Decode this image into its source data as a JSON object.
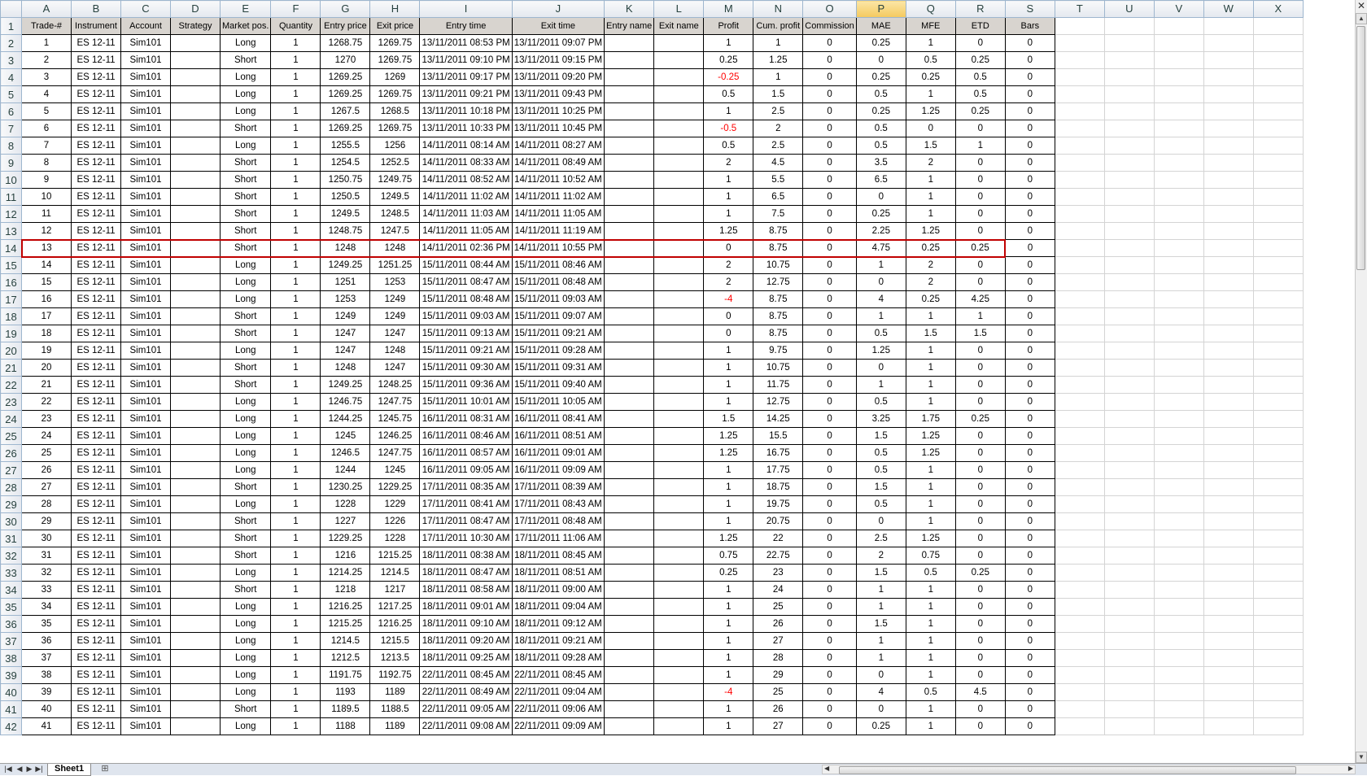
{
  "column_letters": [
    "A",
    "B",
    "C",
    "D",
    "E",
    "F",
    "G",
    "H",
    "I",
    "J",
    "K",
    "L",
    "M",
    "N",
    "O",
    "P",
    "Q",
    "R",
    "S",
    "T",
    "U",
    "V",
    "W",
    "X"
  ],
  "selected_column": "P",
  "headers": [
    "Trade-#",
    "Instrument",
    "Account",
    "Strategy",
    "Market pos.",
    "Quantity",
    "Entry price",
    "Exit price",
    "Entry time",
    "Exit time",
    "Entry name",
    "Exit name",
    "Profit",
    "Cum. profit",
    "Commission",
    "MAE",
    "MFE",
    "ETD",
    "Bars"
  ],
  "highlighted_row": 14,
  "rows": [
    [
      "1",
      "ES 12-11",
      "Sim101",
      "",
      "Long",
      "1",
      "1268.75",
      "1269.75",
      "13/11/2011 08:53 PM",
      "13/11/2011 09:07 PM",
      "",
      "",
      "1",
      "1",
      "0",
      "0.25",
      "1",
      "0",
      "0"
    ],
    [
      "2",
      "ES 12-11",
      "Sim101",
      "",
      "Short",
      "1",
      "1270",
      "1269.75",
      "13/11/2011 09:10 PM",
      "13/11/2011 09:15 PM",
      "",
      "",
      "0.25",
      "1.25",
      "0",
      "0",
      "0.5",
      "0.25",
      "0"
    ],
    [
      "3",
      "ES 12-11",
      "Sim101",
      "",
      "Long",
      "1",
      "1269.25",
      "1269",
      "13/11/2011 09:17 PM",
      "13/11/2011 09:20 PM",
      "",
      "",
      "-0.25",
      "1",
      "0",
      "0.25",
      "0.25",
      "0.5",
      "0"
    ],
    [
      "4",
      "ES 12-11",
      "Sim101",
      "",
      "Long",
      "1",
      "1269.25",
      "1269.75",
      "13/11/2011 09:21 PM",
      "13/11/2011 09:43 PM",
      "",
      "",
      "0.5",
      "1.5",
      "0",
      "0.5",
      "1",
      "0.5",
      "0"
    ],
    [
      "5",
      "ES 12-11",
      "Sim101",
      "",
      "Long",
      "1",
      "1267.5",
      "1268.5",
      "13/11/2011 10:18 PM",
      "13/11/2011 10:25 PM",
      "",
      "",
      "1",
      "2.5",
      "0",
      "0.25",
      "1.25",
      "0.25",
      "0"
    ],
    [
      "6",
      "ES 12-11",
      "Sim101",
      "",
      "Short",
      "1",
      "1269.25",
      "1269.75",
      "13/11/2011 10:33 PM",
      "13/11/2011 10:45 PM",
      "",
      "",
      "-0.5",
      "2",
      "0",
      "0.5",
      "0",
      "0",
      "0"
    ],
    [
      "7",
      "ES 12-11",
      "Sim101",
      "",
      "Long",
      "1",
      "1255.5",
      "1256",
      "14/11/2011 08:14 AM",
      "14/11/2011 08:27 AM",
      "",
      "",
      "0.5",
      "2.5",
      "0",
      "0.5",
      "1.5",
      "1",
      "0"
    ],
    [
      "8",
      "ES 12-11",
      "Sim101",
      "",
      "Short",
      "1",
      "1254.5",
      "1252.5",
      "14/11/2011 08:33 AM",
      "14/11/2011 08:49 AM",
      "",
      "",
      "2",
      "4.5",
      "0",
      "3.5",
      "2",
      "0",
      "0"
    ],
    [
      "9",
      "ES 12-11",
      "Sim101",
      "",
      "Short",
      "1",
      "1250.75",
      "1249.75",
      "14/11/2011 08:52 AM",
      "14/11/2011 10:52 AM",
      "",
      "",
      "1",
      "5.5",
      "0",
      "6.5",
      "1",
      "0",
      "0"
    ],
    [
      "10",
      "ES 12-11",
      "Sim101",
      "",
      "Short",
      "1",
      "1250.5",
      "1249.5",
      "14/11/2011 11:02 AM",
      "14/11/2011 11:02 AM",
      "",
      "",
      "1",
      "6.5",
      "0",
      "0",
      "1",
      "0",
      "0"
    ],
    [
      "11",
      "ES 12-11",
      "Sim101",
      "",
      "Short",
      "1",
      "1249.5",
      "1248.5",
      "14/11/2011 11:03 AM",
      "14/11/2011 11:05 AM",
      "",
      "",
      "1",
      "7.5",
      "0",
      "0.25",
      "1",
      "0",
      "0"
    ],
    [
      "12",
      "ES 12-11",
      "Sim101",
      "",
      "Short",
      "1",
      "1248.75",
      "1247.5",
      "14/11/2011 11:05 AM",
      "14/11/2011 11:19 AM",
      "",
      "",
      "1.25",
      "8.75",
      "0",
      "2.25",
      "1.25",
      "0",
      "0"
    ],
    [
      "13",
      "ES 12-11",
      "Sim101",
      "",
      "Short",
      "1",
      "1248",
      "1248",
      "14/11/2011 02:36 PM",
      "14/11/2011 10:55 PM",
      "",
      "",
      "0",
      "8.75",
      "0",
      "4.75",
      "0.25",
      "0.25",
      "0"
    ],
    [
      "14",
      "ES 12-11",
      "Sim101",
      "",
      "Long",
      "1",
      "1249.25",
      "1251.25",
      "15/11/2011 08:44 AM",
      "15/11/2011 08:46 AM",
      "",
      "",
      "2",
      "10.75",
      "0",
      "1",
      "2",
      "0",
      "0"
    ],
    [
      "15",
      "ES 12-11",
      "Sim101",
      "",
      "Long",
      "1",
      "1251",
      "1253",
      "15/11/2011 08:47 AM",
      "15/11/2011 08:48 AM",
      "",
      "",
      "2",
      "12.75",
      "0",
      "0",
      "2",
      "0",
      "0"
    ],
    [
      "16",
      "ES 12-11",
      "Sim101",
      "",
      "Long",
      "1",
      "1253",
      "1249",
      "15/11/2011 08:48 AM",
      "15/11/2011 09:03 AM",
      "",
      "",
      "-4",
      "8.75",
      "0",
      "4",
      "0.25",
      "4.25",
      "0"
    ],
    [
      "17",
      "ES 12-11",
      "Sim101",
      "",
      "Short",
      "1",
      "1249",
      "1249",
      "15/11/2011 09:03 AM",
      "15/11/2011 09:07 AM",
      "",
      "",
      "0",
      "8.75",
      "0",
      "1",
      "1",
      "1",
      "0"
    ],
    [
      "18",
      "ES 12-11",
      "Sim101",
      "",
      "Short",
      "1",
      "1247",
      "1247",
      "15/11/2011 09:13 AM",
      "15/11/2011 09:21 AM",
      "",
      "",
      "0",
      "8.75",
      "0",
      "0.5",
      "1.5",
      "1.5",
      "0"
    ],
    [
      "19",
      "ES 12-11",
      "Sim101",
      "",
      "Long",
      "1",
      "1247",
      "1248",
      "15/11/2011 09:21 AM",
      "15/11/2011 09:28 AM",
      "",
      "",
      "1",
      "9.75",
      "0",
      "1.25",
      "1",
      "0",
      "0"
    ],
    [
      "20",
      "ES 12-11",
      "Sim101",
      "",
      "Short",
      "1",
      "1248",
      "1247",
      "15/11/2011 09:30 AM",
      "15/11/2011 09:31 AM",
      "",
      "",
      "1",
      "10.75",
      "0",
      "0",
      "1",
      "0",
      "0"
    ],
    [
      "21",
      "ES 12-11",
      "Sim101",
      "",
      "Short",
      "1",
      "1249.25",
      "1248.25",
      "15/11/2011 09:36 AM",
      "15/11/2011 09:40 AM",
      "",
      "",
      "1",
      "11.75",
      "0",
      "1",
      "1",
      "0",
      "0"
    ],
    [
      "22",
      "ES 12-11",
      "Sim101",
      "",
      "Long",
      "1",
      "1246.75",
      "1247.75",
      "15/11/2011 10:01 AM",
      "15/11/2011 10:05 AM",
      "",
      "",
      "1",
      "12.75",
      "0",
      "0.5",
      "1",
      "0",
      "0"
    ],
    [
      "23",
      "ES 12-11",
      "Sim101",
      "",
      "Long",
      "1",
      "1244.25",
      "1245.75",
      "16/11/2011 08:31 AM",
      "16/11/2011 08:41 AM",
      "",
      "",
      "1.5",
      "14.25",
      "0",
      "3.25",
      "1.75",
      "0.25",
      "0"
    ],
    [
      "24",
      "ES 12-11",
      "Sim101",
      "",
      "Long",
      "1",
      "1245",
      "1246.25",
      "16/11/2011 08:46 AM",
      "16/11/2011 08:51 AM",
      "",
      "",
      "1.25",
      "15.5",
      "0",
      "1.5",
      "1.25",
      "0",
      "0"
    ],
    [
      "25",
      "ES 12-11",
      "Sim101",
      "",
      "Long",
      "1",
      "1246.5",
      "1247.75",
      "16/11/2011 08:57 AM",
      "16/11/2011 09:01 AM",
      "",
      "",
      "1.25",
      "16.75",
      "0",
      "0.5",
      "1.25",
      "0",
      "0"
    ],
    [
      "26",
      "ES 12-11",
      "Sim101",
      "",
      "Long",
      "1",
      "1244",
      "1245",
      "16/11/2011 09:05 AM",
      "16/11/2011 09:09 AM",
      "",
      "",
      "1",
      "17.75",
      "0",
      "0.5",
      "1",
      "0",
      "0"
    ],
    [
      "27",
      "ES 12-11",
      "Sim101",
      "",
      "Short",
      "1",
      "1230.25",
      "1229.25",
      "17/11/2011 08:35 AM",
      "17/11/2011 08:39 AM",
      "",
      "",
      "1",
      "18.75",
      "0",
      "1.5",
      "1",
      "0",
      "0"
    ],
    [
      "28",
      "ES 12-11",
      "Sim101",
      "",
      "Long",
      "1",
      "1228",
      "1229",
      "17/11/2011 08:41 AM",
      "17/11/2011 08:43 AM",
      "",
      "",
      "1",
      "19.75",
      "0",
      "0.5",
      "1",
      "0",
      "0"
    ],
    [
      "29",
      "ES 12-11",
      "Sim101",
      "",
      "Short",
      "1",
      "1227",
      "1226",
      "17/11/2011 08:47 AM",
      "17/11/2011 08:48 AM",
      "",
      "",
      "1",
      "20.75",
      "0",
      "0",
      "1",
      "0",
      "0"
    ],
    [
      "30",
      "ES 12-11",
      "Sim101",
      "",
      "Short",
      "1",
      "1229.25",
      "1228",
      "17/11/2011 10:30 AM",
      "17/11/2011 11:06 AM",
      "",
      "",
      "1.25",
      "22",
      "0",
      "2.5",
      "1.25",
      "0",
      "0"
    ],
    [
      "31",
      "ES 12-11",
      "Sim101",
      "",
      "Short",
      "1",
      "1216",
      "1215.25",
      "18/11/2011 08:38 AM",
      "18/11/2011 08:45 AM",
      "",
      "",
      "0.75",
      "22.75",
      "0",
      "2",
      "0.75",
      "0",
      "0"
    ],
    [
      "32",
      "ES 12-11",
      "Sim101",
      "",
      "Long",
      "1",
      "1214.25",
      "1214.5",
      "18/11/2011 08:47 AM",
      "18/11/2011 08:51 AM",
      "",
      "",
      "0.25",
      "23",
      "0",
      "1.5",
      "0.5",
      "0.25",
      "0"
    ],
    [
      "33",
      "ES 12-11",
      "Sim101",
      "",
      "Short",
      "1",
      "1218",
      "1217",
      "18/11/2011 08:58 AM",
      "18/11/2011 09:00 AM",
      "",
      "",
      "1",
      "24",
      "0",
      "1",
      "1",
      "0",
      "0"
    ],
    [
      "34",
      "ES 12-11",
      "Sim101",
      "",
      "Long",
      "1",
      "1216.25",
      "1217.25",
      "18/11/2011 09:01 AM",
      "18/11/2011 09:04 AM",
      "",
      "",
      "1",
      "25",
      "0",
      "1",
      "1",
      "0",
      "0"
    ],
    [
      "35",
      "ES 12-11",
      "Sim101",
      "",
      "Long",
      "1",
      "1215.25",
      "1216.25",
      "18/11/2011 09:10 AM",
      "18/11/2011 09:12 AM",
      "",
      "",
      "1",
      "26",
      "0",
      "1.5",
      "1",
      "0",
      "0"
    ],
    [
      "36",
      "ES 12-11",
      "Sim101",
      "",
      "Long",
      "1",
      "1214.5",
      "1215.5",
      "18/11/2011 09:20 AM",
      "18/11/2011 09:21 AM",
      "",
      "",
      "1",
      "27",
      "0",
      "1",
      "1",
      "0",
      "0"
    ],
    [
      "37",
      "ES 12-11",
      "Sim101",
      "",
      "Long",
      "1",
      "1212.5",
      "1213.5",
      "18/11/2011 09:25 AM",
      "18/11/2011 09:28 AM",
      "",
      "",
      "1",
      "28",
      "0",
      "1",
      "1",
      "0",
      "0"
    ],
    [
      "38",
      "ES 12-11",
      "Sim101",
      "",
      "Long",
      "1",
      "1191.75",
      "1192.75",
      "22/11/2011 08:45 AM",
      "22/11/2011 08:45 AM",
      "",
      "",
      "1",
      "29",
      "0",
      "0",
      "1",
      "0",
      "0"
    ],
    [
      "39",
      "ES 12-11",
      "Sim101",
      "",
      "Long",
      "1",
      "1193",
      "1189",
      "22/11/2011 08:49 AM",
      "22/11/2011 09:04 AM",
      "",
      "",
      "-4",
      "25",
      "0",
      "4",
      "0.5",
      "4.5",
      "0"
    ],
    [
      "40",
      "ES 12-11",
      "Sim101",
      "",
      "Short",
      "1",
      "1189.5",
      "1188.5",
      "22/11/2011 09:05 AM",
      "22/11/2011 09:06 AM",
      "",
      "",
      "1",
      "26",
      "0",
      "0",
      "1",
      "0",
      "0"
    ],
    [
      "41",
      "ES 12-11",
      "Sim101",
      "",
      "Long",
      "1",
      "1188",
      "1189",
      "22/11/2011 09:08 AM",
      "22/11/2011 09:09 AM",
      "",
      "",
      "1",
      "27",
      "0",
      "0.25",
      "1",
      "0",
      "0"
    ]
  ],
  "sheet_tab": "Sheet1",
  "colors": {
    "negative": "#ff0000",
    "selection_border": "#c00000",
    "header_fill": "#d8d4cf"
  }
}
